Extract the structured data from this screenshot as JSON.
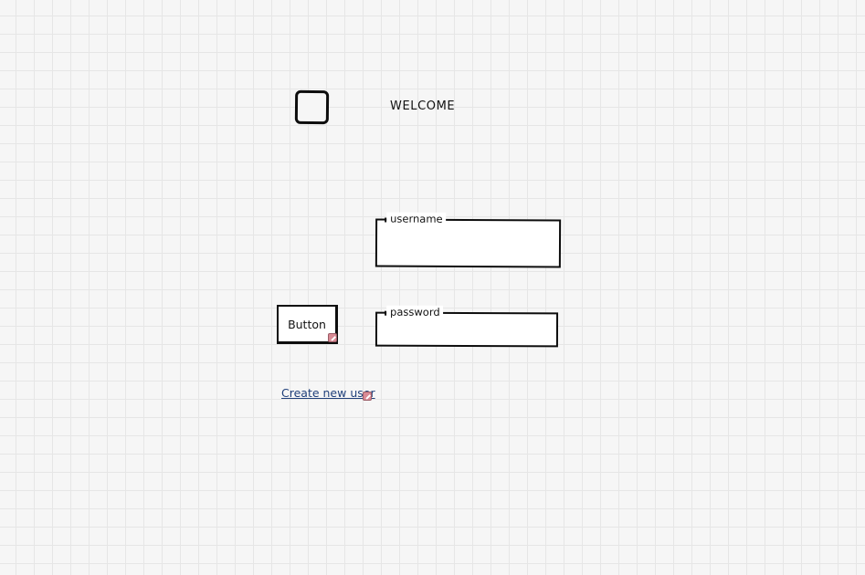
{
  "header": {
    "title": "WELCOME"
  },
  "form": {
    "username_label": "username",
    "username_value": "",
    "password_label": "password",
    "password_value": "",
    "button_label": "Button",
    "create_user_link": "Create new user"
  },
  "icons": {
    "checkbox": "checkbox-icon",
    "link_indicator": "link-indicator-icon"
  },
  "colors": {
    "link": "#1f3f7a",
    "canvas_bg": "#f6f6f6",
    "grid_line": "#e6e6e6",
    "link_indicator": "#d98a94"
  }
}
